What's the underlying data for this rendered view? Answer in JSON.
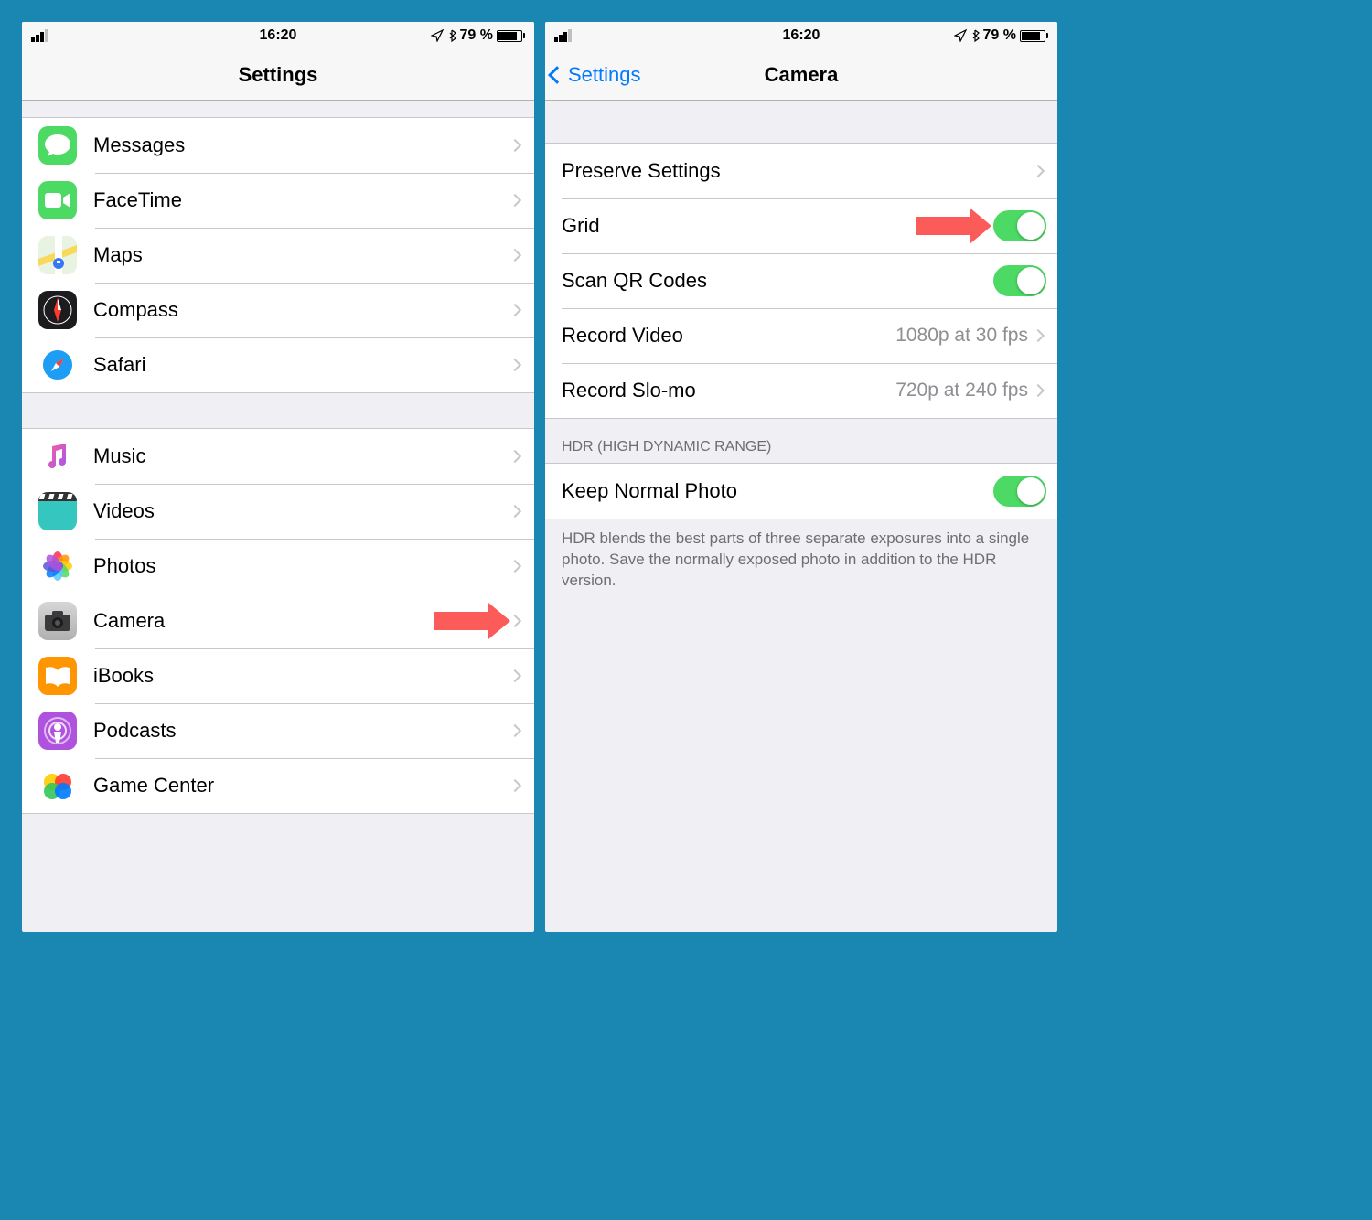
{
  "status": {
    "time": "16:20",
    "battery_pct": "79 %"
  },
  "left": {
    "title": "Settings",
    "group1": [
      {
        "label": "Messages"
      },
      {
        "label": "FaceTime"
      },
      {
        "label": "Maps"
      },
      {
        "label": "Compass"
      },
      {
        "label": "Safari"
      }
    ],
    "group2": [
      {
        "label": "Music"
      },
      {
        "label": "Videos"
      },
      {
        "label": "Photos"
      },
      {
        "label": "Camera"
      },
      {
        "label": "iBooks"
      },
      {
        "label": "Podcasts"
      },
      {
        "label": "Game Center"
      }
    ]
  },
  "right": {
    "back": "Settings",
    "title": "Camera",
    "rows": {
      "preserve": "Preserve Settings",
      "grid": "Grid",
      "qr": "Scan QR Codes",
      "recvid": "Record Video",
      "recvid_detail": "1080p at 30 fps",
      "recslo": "Record Slo-mo",
      "recslo_detail": "720p at 240 fps"
    },
    "hdr_header": "HDR (High Dynamic Range)",
    "keep": "Keep Normal Photo",
    "hdr_footer": "HDR blends the best parts of three separate exposures into a single photo. Save the normally exposed photo in addition to the HDR version."
  }
}
